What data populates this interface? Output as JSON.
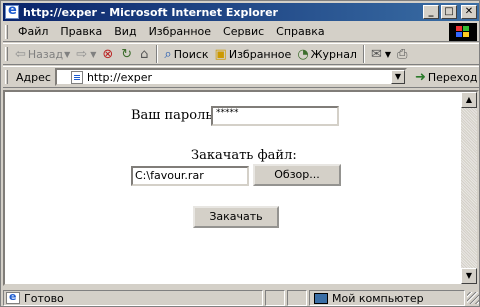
{
  "window": {
    "title": "http://exper - Microsoft Internet Explorer",
    "controls": {
      "minimize": "_",
      "maximize": "□",
      "close": "✕"
    }
  },
  "menu": [
    "Файл",
    "Правка",
    "Вид",
    "Избранное",
    "Сервис",
    "Справка"
  ],
  "toolbar": {
    "back_label": "Назад",
    "search_label": "Поиск",
    "favorites_label": "Избранное",
    "journal_label": "Журнал"
  },
  "address": {
    "label": "Адрес",
    "url": "http://exper",
    "go_label": "Переход"
  },
  "form": {
    "password_label": "Ваш пароль:",
    "password_value": "*****",
    "upload_label": "Закачать файл:",
    "file_value": "C:\\favour.rar",
    "browse_label": "Обзор...",
    "download_label": "Закачать"
  },
  "status": {
    "text": "Готово",
    "zone": "Мой компьютер"
  }
}
